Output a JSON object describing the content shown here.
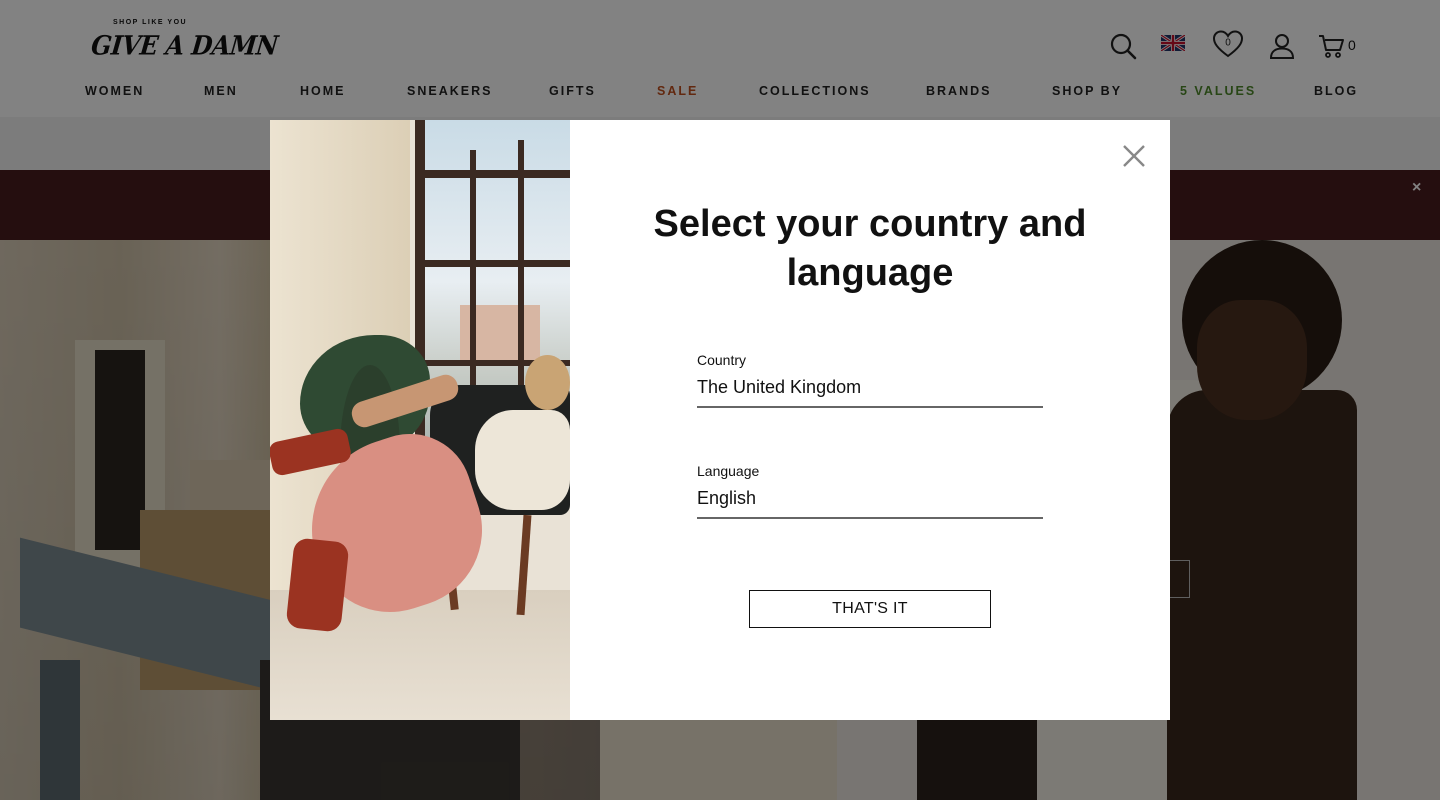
{
  "header": {
    "logo_tagline": "SHOP LIKE YOU",
    "logo_text": "GIVE A DAMN",
    "wishlist_count": "0",
    "cart_count": "0"
  },
  "nav": {
    "items": [
      "WOMEN",
      "MEN",
      "HOME",
      "SNEAKERS",
      "GIFTS",
      "SALE",
      "COLLECTIONS",
      "BRANDS",
      "SHOP BY",
      "5 VALUES",
      "BLOG"
    ]
  },
  "promo": {
    "close_label": "×"
  },
  "colors": {
    "sale": "#c0501e",
    "values": "#4f8a2b",
    "promo_bar": "#4a1d1e"
  },
  "modal": {
    "title": "Select your country and language",
    "country_label": "Country",
    "country_value": "The United Kingdom",
    "language_label": "Language",
    "language_value": "English",
    "submit_label": "THAT'S IT"
  },
  "icons": [
    "search-icon",
    "uk-flag-icon",
    "heart-icon",
    "user-icon",
    "cart-icon",
    "close-icon"
  ]
}
